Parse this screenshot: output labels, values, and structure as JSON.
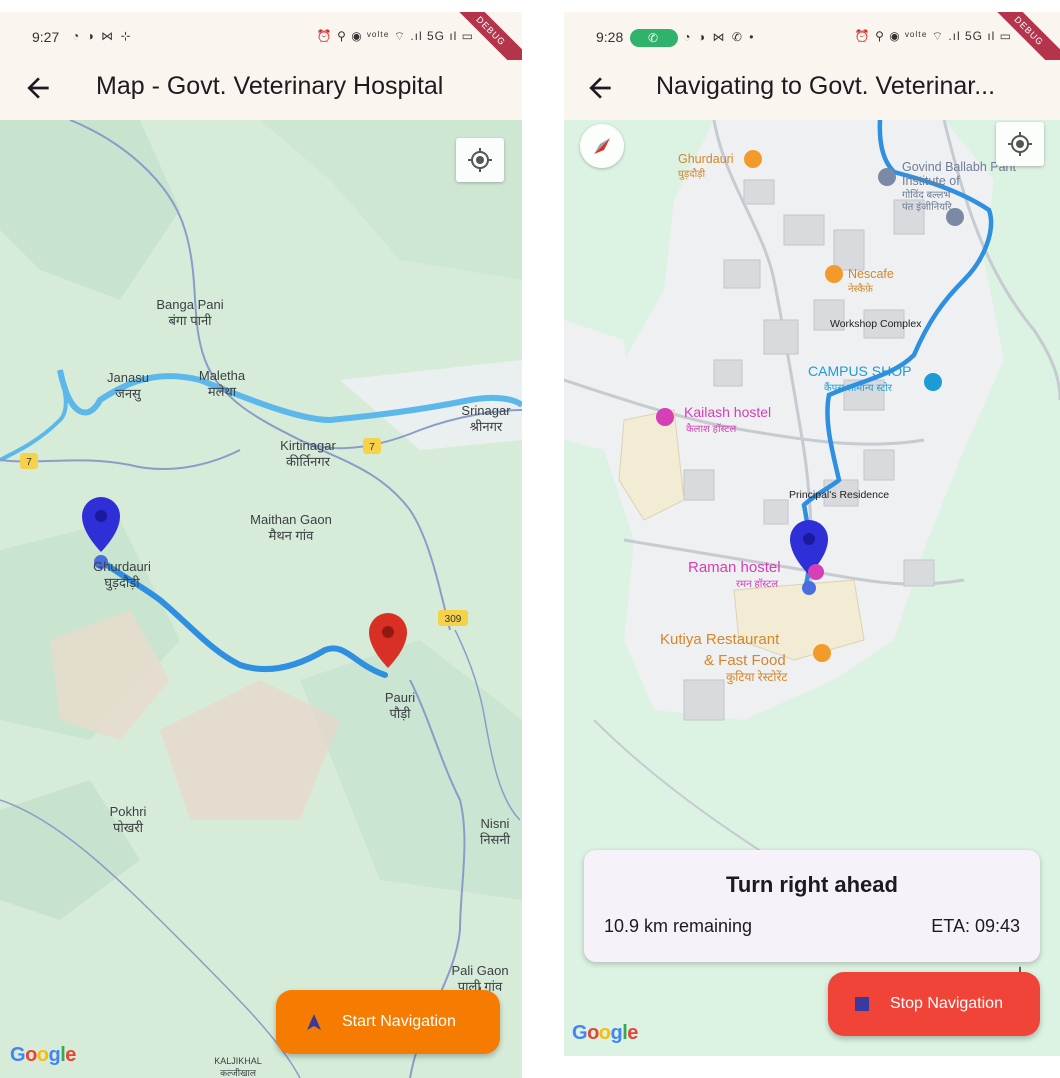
{
  "left": {
    "status": {
      "time": "9:27",
      "icons": "◔ ◑ ⋈ ⊹",
      "right": "⏰ ⚲ ◉ ᵛᵒˡᵗᵉ ⌔ .ıl 5G ıl ▭"
    },
    "app_bar": {
      "title": "Map - Govt. Veterinary Hospital"
    },
    "map_labels": {
      "banga_pani": "Banga Pani",
      "banga_pani_hi": "बंगा पानी",
      "janasu": "Janasu",
      "janasu_hi": "जनसु",
      "maletha": "Maletha",
      "maletha_hi": "मलेथा",
      "srinagar": "Srinagar",
      "srinagar_hi": "श्रीनगर",
      "kirtinagar": "Kirtinagar",
      "kirtinagar_hi": "कीर्तिनगर",
      "maithan_gaon": "Maithan Gaon",
      "maithan_gaon_hi": "मैथन गांव",
      "ghurdauri": "Ghurdauri",
      "ghurdauri_hi": "घुड़दौड़ी",
      "pauri": "Pauri",
      "pauri_hi": "पौड़ी",
      "pokhri": "Pokhri",
      "pokhri_hi": "पोखरी",
      "nisni": "Nisni",
      "nisni_hi": "निसनी",
      "pali_gaon": "Pali Gaon",
      "pali_gaon_hi": "पाली गांव",
      "kaljikhal": "KALJIKHAL",
      "kaljikhal_hi": "कल्जीखाल",
      "road_7": "7",
      "road_309": "309"
    },
    "start_button": "Start Navigation",
    "start_button_color": "#f57c00"
  },
  "right": {
    "status": {
      "time": "9:28",
      "icons": "◔ ◑ ⋈ ✆ •",
      "right": "⏰ ⚲ ◉ ᵛᵒˡᵗᵉ ⌔ .ıl 5G ıl ▭"
    },
    "app_bar": {
      "title": "Navigating to Govt. Veterinar..."
    },
    "map_labels": {
      "ghurdauri": "Ghurdauri",
      "ghurdauri_hi": "घुड़दौड़ी",
      "govind_ballabh": "Govind Ballabh Pant",
      "govind_institute": "Institute of",
      "govind_hi_1": "गोविंद बल्लभ",
      "govind_hi_2": "पंत इंजीनियरि",
      "nescafe": "Nescafe",
      "nescafe_hi": "नेस्कैफ़े",
      "workshop": "Workshop Complex",
      "campus_shop": "CAMPUS SHOP",
      "campus_shop_hi": "कैंपस सामान्य स्टोर",
      "kailash": "Kailash hostel",
      "kailash_hi": "कैलाश हॉस्टल",
      "principal": "Principal's Residence",
      "raman": "Raman hostel",
      "raman_hi": "रमन हॉस्टल",
      "kutiya_1": "Kutiya Restaurant",
      "kutiya_2": "& Fast Food",
      "kutiya_hi": "कुटिया रेस्टोरेंट"
    },
    "card": {
      "instruction": "Turn right ahead",
      "remaining": "10.9 km remaining",
      "eta": "ETA: 09:43"
    },
    "stop_button": "Stop Navigation",
    "stop_button_color": "#f04438"
  },
  "google_logo": {
    "g": "G",
    "o1": "o",
    "o2": "o",
    "g2": "g",
    "l": "l",
    "e": "e"
  },
  "debug_banner": "DEBUG",
  "colors": {
    "route": "#2f8fe0",
    "origin_pin": "#2f2fd8",
    "destination_pin": "#d93025",
    "map_green": "#d8efdc",
    "river": "#5cb8ea",
    "road": "#8b9cc9"
  }
}
